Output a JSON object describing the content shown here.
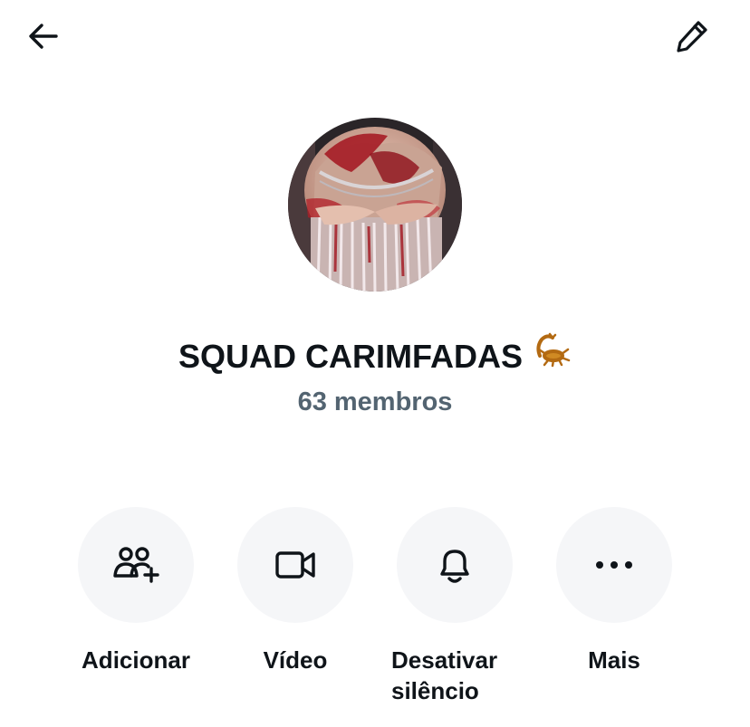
{
  "header": {
    "back_icon": "arrow-left-icon",
    "edit_icon": "pencil-icon"
  },
  "group": {
    "name": "SQUAD CARIMFADAS",
    "name_emoji": "scorpion-emoji",
    "members": "63 membros"
  },
  "actions": [
    {
      "label": "Adicionar",
      "icon": "add-people-icon"
    },
    {
      "label": "Vídeo",
      "icon": "video-camera-icon"
    },
    {
      "label": "Desativar silêncio",
      "icon": "bell-icon"
    },
    {
      "label": "Mais",
      "icon": "more-dots-icon"
    }
  ],
  "colors": {
    "text": "#0f1419",
    "secondary_text": "#536471",
    "action_circle": "#f5f6f8"
  }
}
